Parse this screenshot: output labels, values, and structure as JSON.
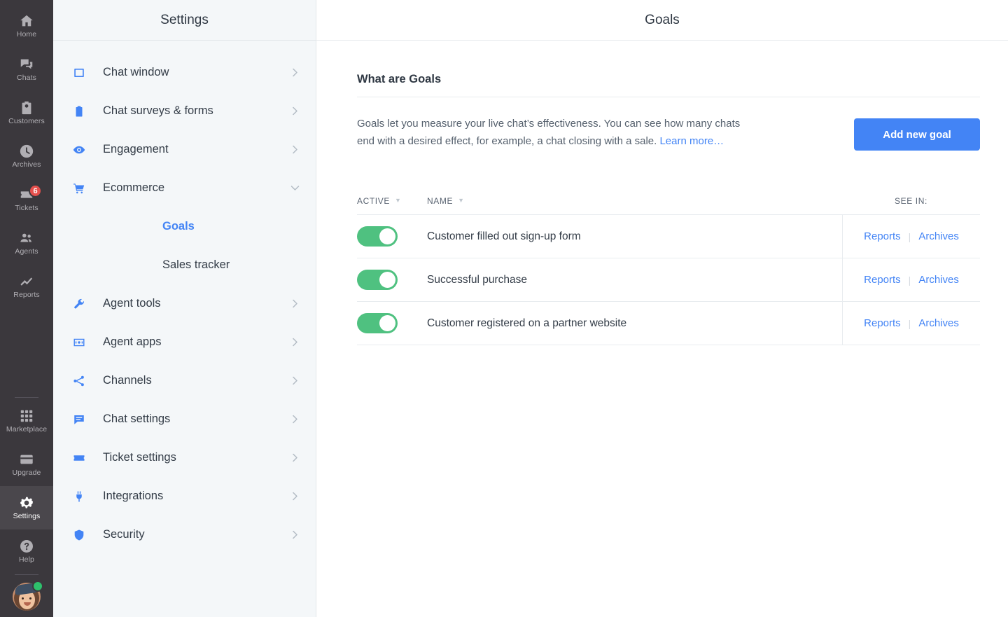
{
  "rail": {
    "items": [
      {
        "label": "Home",
        "icon": "home-icon",
        "badge": null,
        "active": false
      },
      {
        "label": "Chats",
        "icon": "chats-icon",
        "badge": null,
        "active": false
      },
      {
        "label": "Customers",
        "icon": "customers-icon",
        "badge": null,
        "active": false
      },
      {
        "label": "Archives",
        "icon": "archives-icon",
        "badge": null,
        "active": false
      },
      {
        "label": "Tickets",
        "icon": "tickets-icon",
        "badge": "6",
        "active": false
      },
      {
        "label": "Agents",
        "icon": "agents-icon",
        "badge": null,
        "active": false
      },
      {
        "label": "Reports",
        "icon": "reports-icon",
        "badge": null,
        "active": false
      }
    ],
    "bottom_items": [
      {
        "label": "Marketplace",
        "icon": "marketplace-icon",
        "active": false
      },
      {
        "label": "Upgrade",
        "icon": "upgrade-icon",
        "active": false
      },
      {
        "label": "Settings",
        "icon": "gear-icon",
        "active": true
      },
      {
        "label": "Help",
        "icon": "help-icon",
        "active": false
      }
    ]
  },
  "settings": {
    "header_title": "Settings",
    "items": [
      {
        "label": "Chat window",
        "icon": "chat-window-icon",
        "chevron": "right"
      },
      {
        "label": "Chat surveys & forms",
        "icon": "clipboard-icon",
        "chevron": "right"
      },
      {
        "label": "Engagement",
        "icon": "eye-icon",
        "chevron": "right"
      },
      {
        "label": "Ecommerce",
        "icon": "cart-icon",
        "chevron": "down"
      }
    ],
    "ecommerce_subitems": [
      {
        "label": "Goals",
        "selected": true
      },
      {
        "label": "Sales tracker",
        "selected": false
      }
    ],
    "items_after": [
      {
        "label": "Agent tools",
        "icon": "wrench-icon",
        "chevron": "right"
      },
      {
        "label": "Agent apps",
        "icon": "agent-apps-icon",
        "chevron": "right"
      },
      {
        "label": "Channels",
        "icon": "channels-icon",
        "chevron": "right"
      },
      {
        "label": "Chat settings",
        "icon": "chat-bubble-icon",
        "chevron": "right"
      },
      {
        "label": "Ticket settings",
        "icon": "ticket-icon",
        "chevron": "right"
      },
      {
        "label": "Integrations",
        "icon": "plug-icon",
        "chevron": "right"
      },
      {
        "label": "Security",
        "icon": "shield-icon",
        "chevron": "right"
      }
    ]
  },
  "main": {
    "header_title": "Goals",
    "section_title": "What are Goals",
    "intro_text_1": "Goals let you measure your live chat’s effectiveness. You can see how many chats end with a desired effect, for example, a chat closing with a sale. ",
    "intro_link": "Learn more…",
    "add_button_label": "Add new goal",
    "table": {
      "columns": {
        "active": "ACTIVE",
        "name": "NAME",
        "see_in": "SEE IN:"
      },
      "sort_arrow": "▼",
      "rows": [
        {
          "active": true,
          "name": "Customer filled out sign-up form",
          "reports": "Reports",
          "archives": "Archives"
        },
        {
          "active": true,
          "name": "Successful purchase",
          "reports": "Reports",
          "archives": "Archives"
        },
        {
          "active": true,
          "name": "Customer registered on a partner website",
          "reports": "Reports",
          "archives": "Archives"
        }
      ]
    }
  },
  "colors": {
    "rail_bg": "#3b383d",
    "rail_active": "#4a474c",
    "accent_blue": "#4384f5",
    "toggle_green": "#4fc180",
    "badge_red": "#e6504d",
    "panel_bg": "#f4f7f9",
    "status_online": "#2ec06c"
  }
}
